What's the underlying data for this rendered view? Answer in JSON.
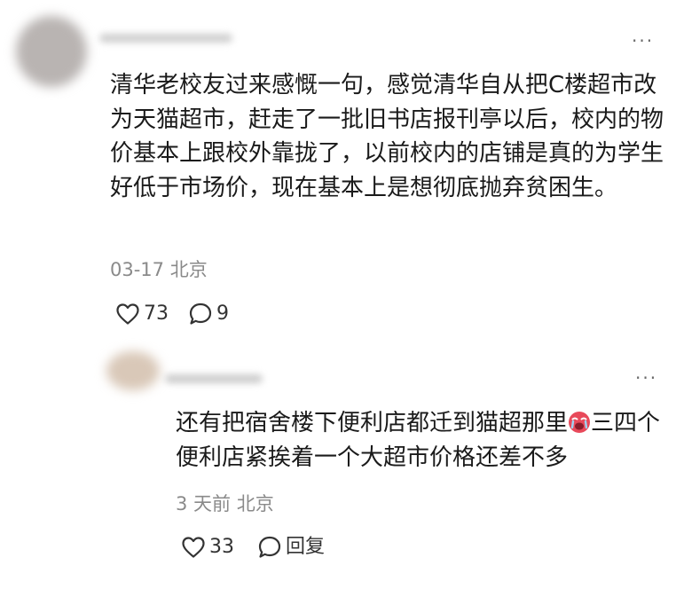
{
  "comments": [
    {
      "text": "清华老校友过来感慨一句，感觉清华自从把C楼超市改为天猫超市，赶走了一批旧书店报刊亭以后，校内的物价基本上跟校外靠拢了，以前校内的店铺是真的为学生好低于市场价，现在基本上是想彻底抛弃贫困生。",
      "meta": "03-17 北京",
      "likes": "73",
      "replies": "9",
      "more": "···"
    },
    {
      "text_before_emoji": "还有把宿舍楼下便利店都迁到猫超那里",
      "text_after_emoji": "三四个便利店紧挨着一个大超市价格还差不多",
      "meta": "3 天前 北京",
      "likes": "33",
      "reply_label": "回复",
      "more": "···",
      "emoji": "crying-face"
    }
  ],
  "colors": {
    "text": "#1a1a1a",
    "meta": "#8a8a8a",
    "icon": "#333333",
    "emoji_red": "#e8495a"
  }
}
